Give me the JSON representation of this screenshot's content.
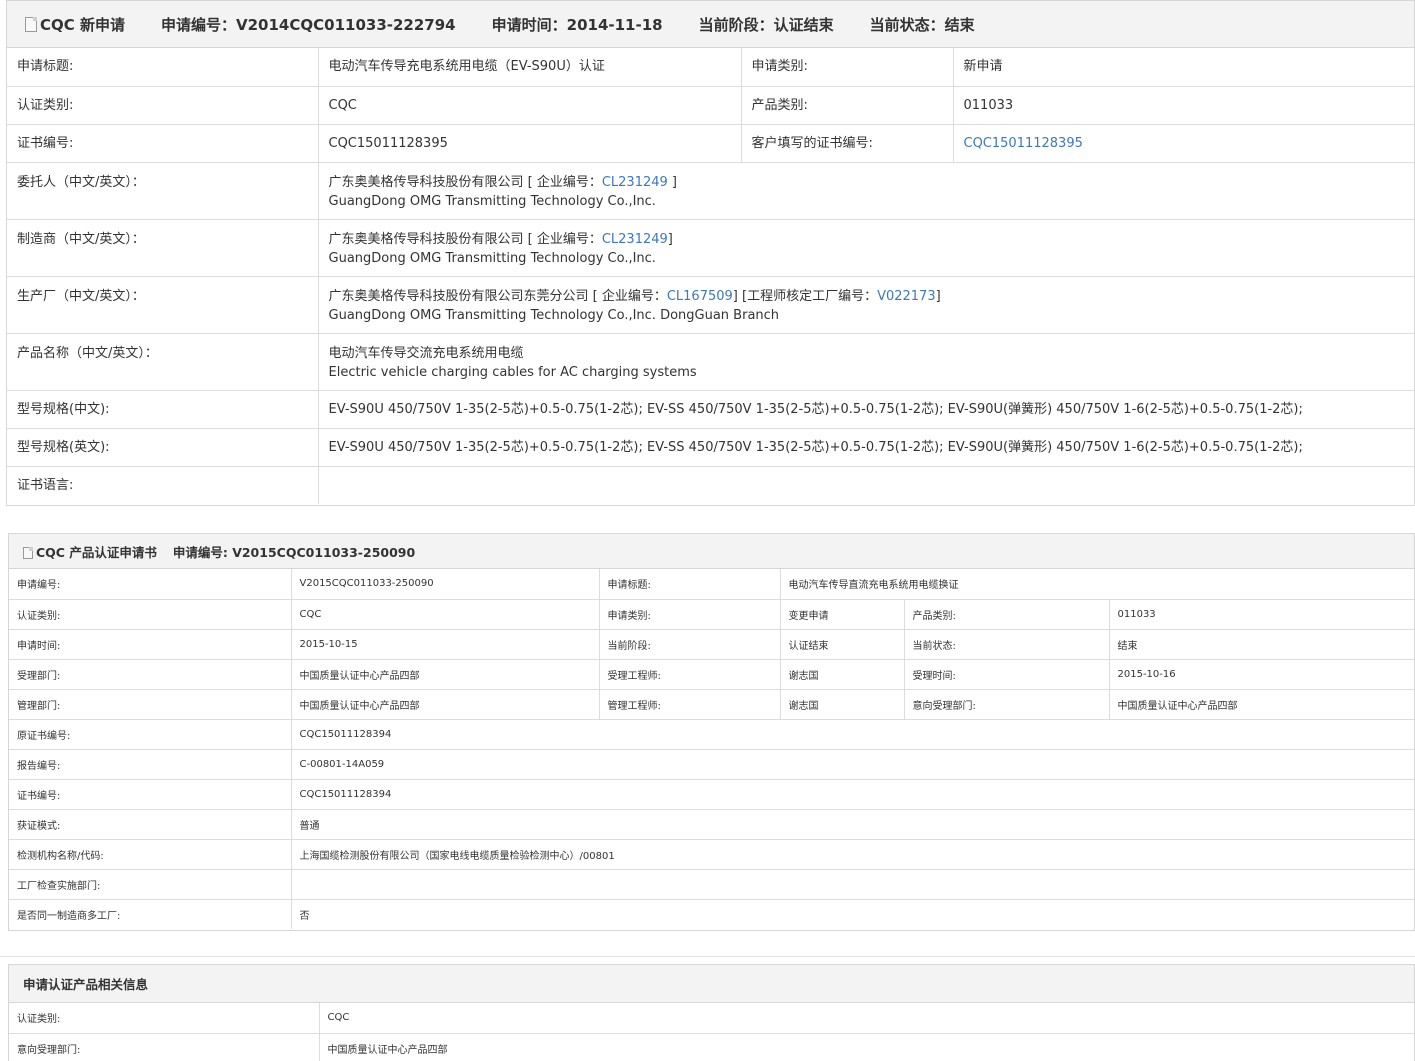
{
  "header1": {
    "title": "CQC 新申请",
    "app_no_label": "申请编号：",
    "app_no": "V2014CQC011033-222794",
    "app_time_label": "申请时间：",
    "app_time": "2014-11-18",
    "stage_label": "当前阶段：",
    "stage": "认证结束",
    "status_label": "当前状态：",
    "status": "结束"
  },
  "panel1": {
    "title_label": "申请标题:",
    "title_value": "电动汽车传导充电系统用电缆（EV-S90U）认证",
    "apptype_label": "申请类别:",
    "apptype_value": "新申请",
    "cert_category_label": "认证类别:",
    "cert_category_value": "CQC",
    "product_category_label": "产品类别:",
    "product_category_value": "011033",
    "cert_no_label": "证书编号:",
    "cert_no_value": "CQC15011128395",
    "customer_cert_no_label": "客户填写的证书编号:",
    "customer_cert_no_value": "CQC15011128395",
    "client_label": "委托人（中文/英文）：",
    "client_cn": "广东奥美格传导科技股份有限公司 [ 企业编号：",
    "client_code": "CL231249",
    "client_close": " ]",
    "client_en": "GuangDong OMG Transmitting Technology Co.,Inc.",
    "maker_label": "制造商（中文/英文）：",
    "maker_cn": "广东奥美格传导科技股份有限公司 [ 企业编号：",
    "maker_code": "CL231249",
    "maker_close": "]",
    "maker_en": "GuangDong OMG Transmitting Technology Co.,Inc.",
    "factory_label": "生产厂（中文/英文）：",
    "factory_cn": "广东奥美格传导科技股份有限公司东莞分公司 [ 企业编号：",
    "factory_code": "CL167509",
    "factory_mid": "] [工程师核定工厂编号：",
    "factory_eng_code": "V022173",
    "factory_close": "]",
    "factory_en": "GuangDong OMG Transmitting Technology Co.,Inc. DongGuan Branch",
    "product_name_label": "产品名称（中文/英文）：",
    "product_name_cn": "电动汽车传导交流充电系统用电缆",
    "product_name_en": "Electric vehicle charging cables for AC charging systems",
    "model_cn_label": "型号规格(中文):",
    "model_cn_value": "EV-S90U 450/750V 1-35(2-5芯)+0.5-0.75(1-2芯); EV-SS 450/750V 1-35(2-5芯)+0.5-0.75(1-2芯); EV-S90U(弹簧形) 450/750V 1-6(2-5芯)+0.5-0.75(1-2芯);",
    "model_en_label": "型号规格(英文):",
    "model_en_value": "EV-S90U 450/750V 1-35(2-5芯)+0.5-0.75(1-2芯); EV-SS 450/750V 1-35(2-5芯)+0.5-0.75(1-2芯); EV-S90U(弹簧形) 450/750V 1-6(2-5芯)+0.5-0.75(1-2芯);",
    "cert_lang_label": "证书语言:",
    "cert_lang_value": ""
  },
  "header2": {
    "title": "CQC 产品认证申请书",
    "app_no_label": "申请编号:",
    "app_no": "V2015CQC011033-250090"
  },
  "panel2": {
    "app_no_label": "申请编号:",
    "app_no_value": "V2015CQC011033-250090",
    "title_label": "申请标题:",
    "title_value": "电动汽车传导直流充电系统用电缆换证",
    "cert_category_label": "认证类别:",
    "cert_category_value": "CQC",
    "apptype_label": "申请类别:",
    "apptype_value": "变更申请",
    "product_category_label": "产品类别:",
    "product_category_value": "011033",
    "app_time_label": "申请时间:",
    "app_time_value": "2015-10-15",
    "stage_label": "当前阶段:",
    "stage_value": "认证结束",
    "status_label": "当前状态:",
    "status_value": "结束",
    "accept_dept_label": "受理部门:",
    "accept_dept_value": "中国质量认证中心产品四部",
    "accept_eng_label": "受理工程师:",
    "accept_eng_value": "谢志国",
    "accept_time_label": "受理时间:",
    "accept_time_value": "2015-10-16",
    "manage_dept_label": "管理部门:",
    "manage_dept_value": "中国质量认证中心产品四部",
    "manage_eng_label": "管理工程师:",
    "manage_eng_value": "谢志国",
    "intended_dept_label": "意向受理部门:",
    "intended_dept_value": "中国质量认证中心产品四部",
    "orig_cert_label": "原证书编号:",
    "orig_cert_value": "CQC15011128394",
    "report_no_label": "报告编号:",
    "report_no_value": "C-00801-14A059",
    "cert_no_label": "证书编号:",
    "cert_no_value": "CQC15011128394",
    "mode_label": "获证模式:",
    "mode_value": "普通",
    "lab_label": "检测机构名称/代码:",
    "lab_value": "上海国缆检测股份有限公司（国家电线电缆质量检验检测中心）/00801",
    "factory_dept_label": "工厂检查实施部门:",
    "factory_dept_value": "",
    "multi_factory_label": "是否同一制造商多工厂:",
    "multi_factory_value": "否"
  },
  "header3": {
    "title": "申请认证产品相关信息"
  },
  "panel3": {
    "cert_category_label": "认证类别:",
    "cert_category_value": "CQC",
    "intended_dept_label": "意向受理部门:",
    "intended_dept_value": "中国质量认证中心产品四部"
  }
}
